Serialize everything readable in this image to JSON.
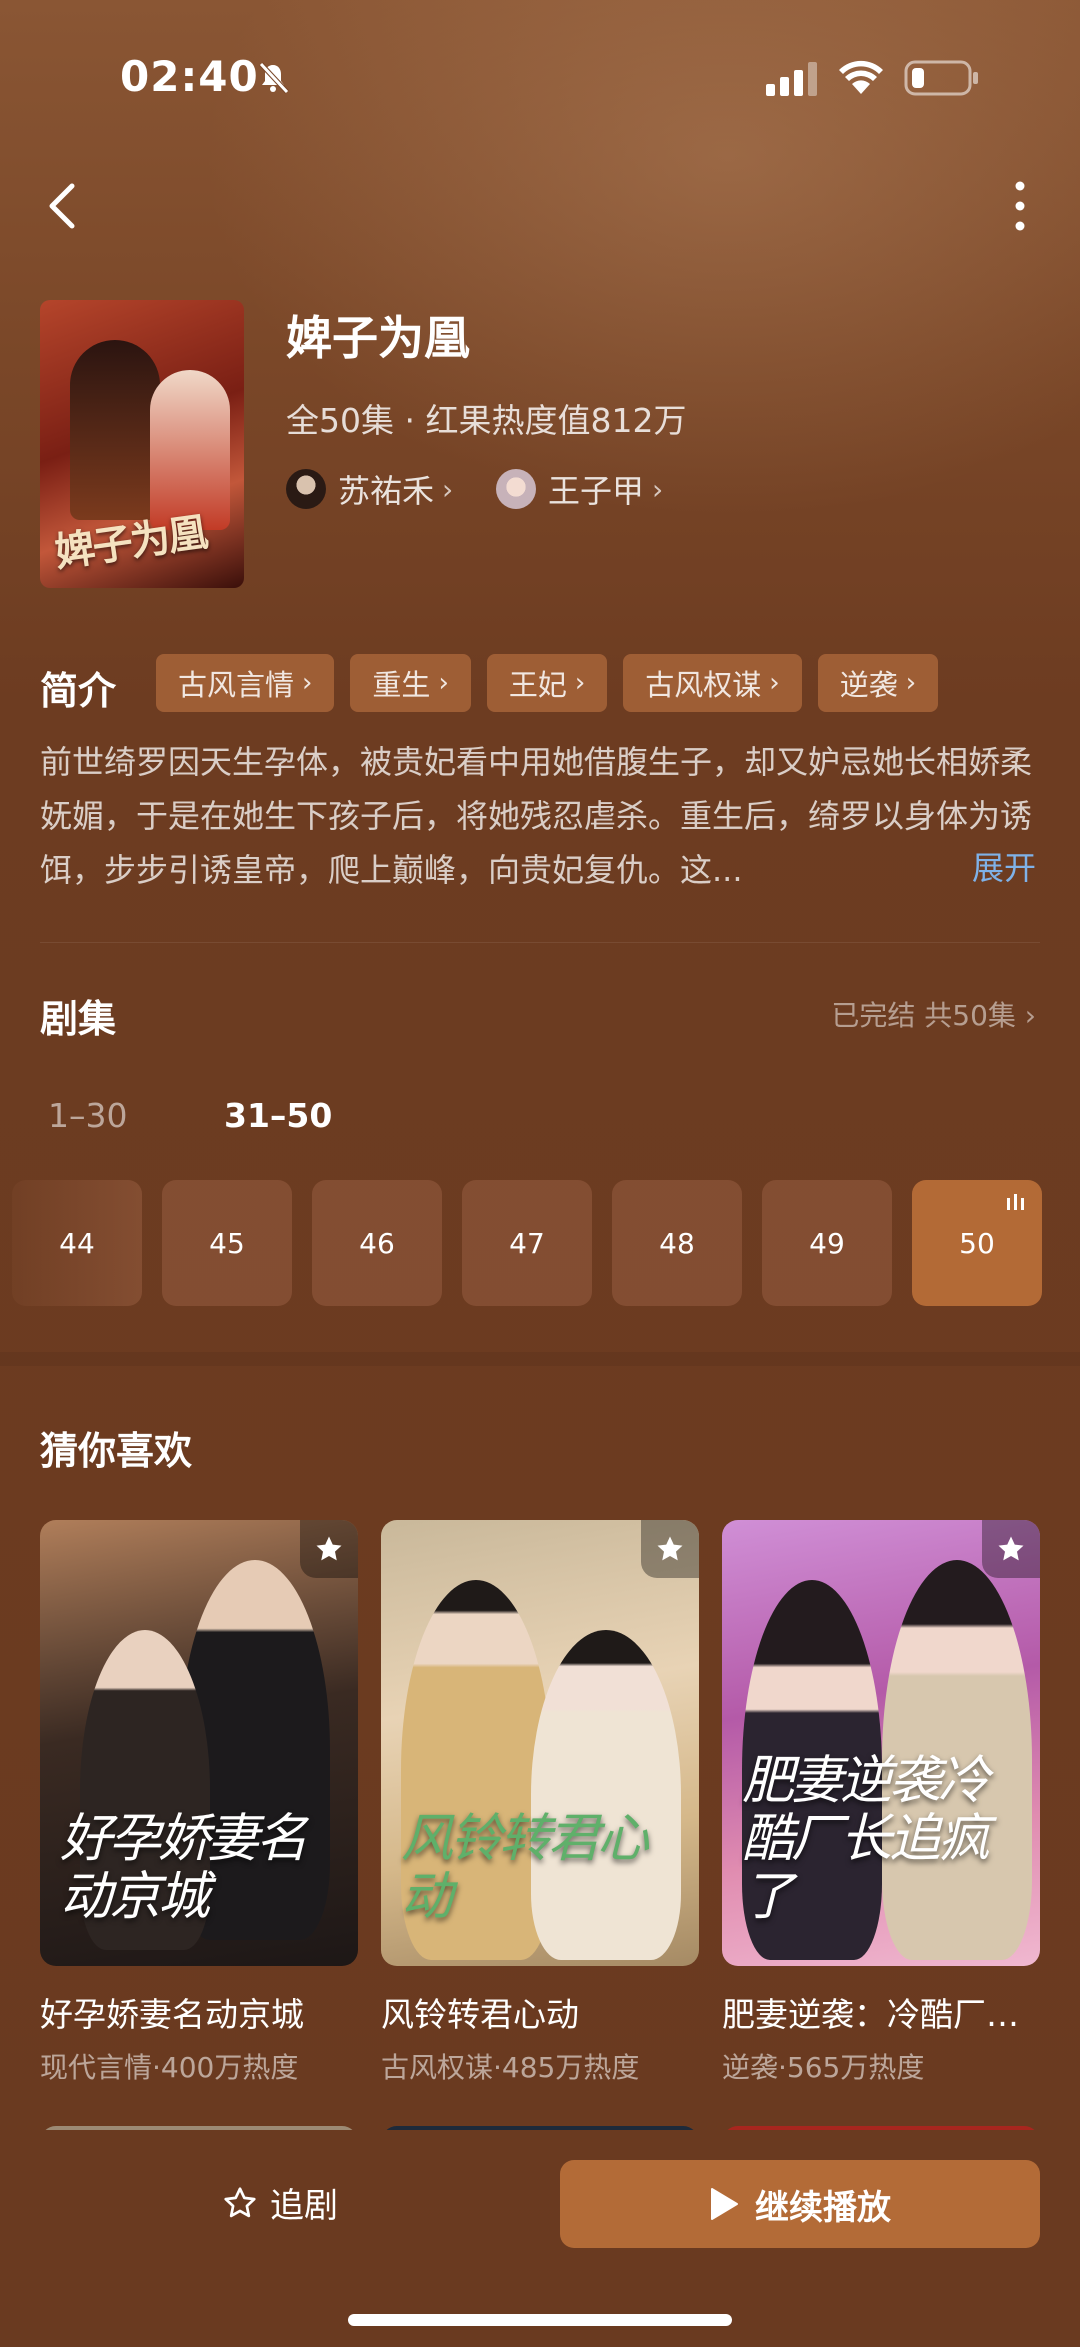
{
  "status_bar": {
    "time": "02:40"
  },
  "show": {
    "title": "婢子为凰",
    "poster_text": "婢子为凰",
    "meta": "全50集 · 红果热度值812万",
    "actors": [
      {
        "name": "苏祐禾"
      },
      {
        "name": "王子甲"
      }
    ]
  },
  "synopsis": {
    "label": "简介",
    "tags": [
      "古风言情",
      "重生",
      "王妃",
      "古风权谋",
      "逆袭"
    ],
    "text": "前世绮罗因天生孕体，被贵妃看中用她借腹生子，却又妒忌她长相娇柔妩媚，于是在她生下孩子后，将她残忍虐杀。重生后，绮罗以身体为诱饵，步步引诱皇帝，爬上巅峰，向贵妃复仇。这...",
    "expand_label": "展开"
  },
  "episodes": {
    "title": "剧集",
    "status": "已完结 共50集",
    "ranges": [
      "1–30",
      "31–50"
    ],
    "selected_range": "31–50",
    "items": [
      "44",
      "45",
      "46",
      "47",
      "48",
      "49",
      "50"
    ],
    "current": "50"
  },
  "recommendations": {
    "title": "猜你喜欢",
    "items": [
      {
        "name": "好孕娇妻名动京城",
        "sub": "现代言情·400万热度",
        "cover_text": "好孕娇妻名动京城"
      },
      {
        "name": "风铃转君心动",
        "sub": "古风权谋·485万热度",
        "cover_text": "风铃转君心动"
      },
      {
        "name": "肥妻逆袭：冷酷厂…",
        "sub": "逆袭·565万热度",
        "cover_text": "肥妻逆袭冷酷厂长追疯了"
      }
    ]
  },
  "bottom_bar": {
    "follow_label": "追剧",
    "play_label": "继续播放"
  },
  "colors": {
    "background": "#6a3a20",
    "accent": "#b36b37",
    "link": "#7fb2e8"
  }
}
